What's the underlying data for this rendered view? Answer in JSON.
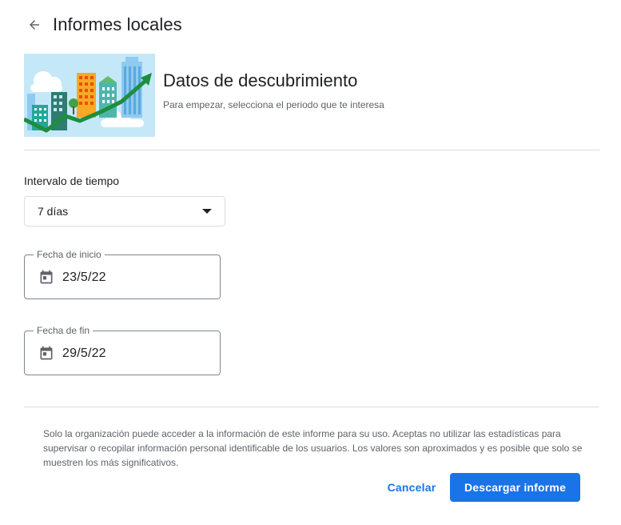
{
  "header": {
    "title": "Informes locales",
    "back_icon": "arrow-left-icon"
  },
  "hero": {
    "illustration": "city-growth-illustration",
    "title": "Datos de descubrimiento",
    "subtitle": "Para empezar, selecciona el periodo que te interesa"
  },
  "interval": {
    "label": "Intervalo de tiempo",
    "selected": "7 días",
    "dropdown_icon": "caret-down-icon"
  },
  "start_date": {
    "label": "Fecha de inicio",
    "value": "23/5/22",
    "icon": "calendar-icon"
  },
  "end_date": {
    "label": "Fecha de fin",
    "value": "29/5/22",
    "icon": "calendar-icon"
  },
  "disclaimer": "Solo la organización puede acceder a la información de este informe para su uso. Aceptas no utilizar las estadísticas para supervisar o recopilar información personal identificable de los usuarios. Los valores son aproximados y es posible que solo se muestren los más significativos.",
  "actions": {
    "cancel_label": "Cancelar",
    "download_label": "Descargar informe"
  },
  "colors": {
    "accent": "#1a73e8",
    "divider": "#dadce0",
    "illustration_sky": "#c5e8f8",
    "illustration_arrow": "#1e8e3e"
  }
}
